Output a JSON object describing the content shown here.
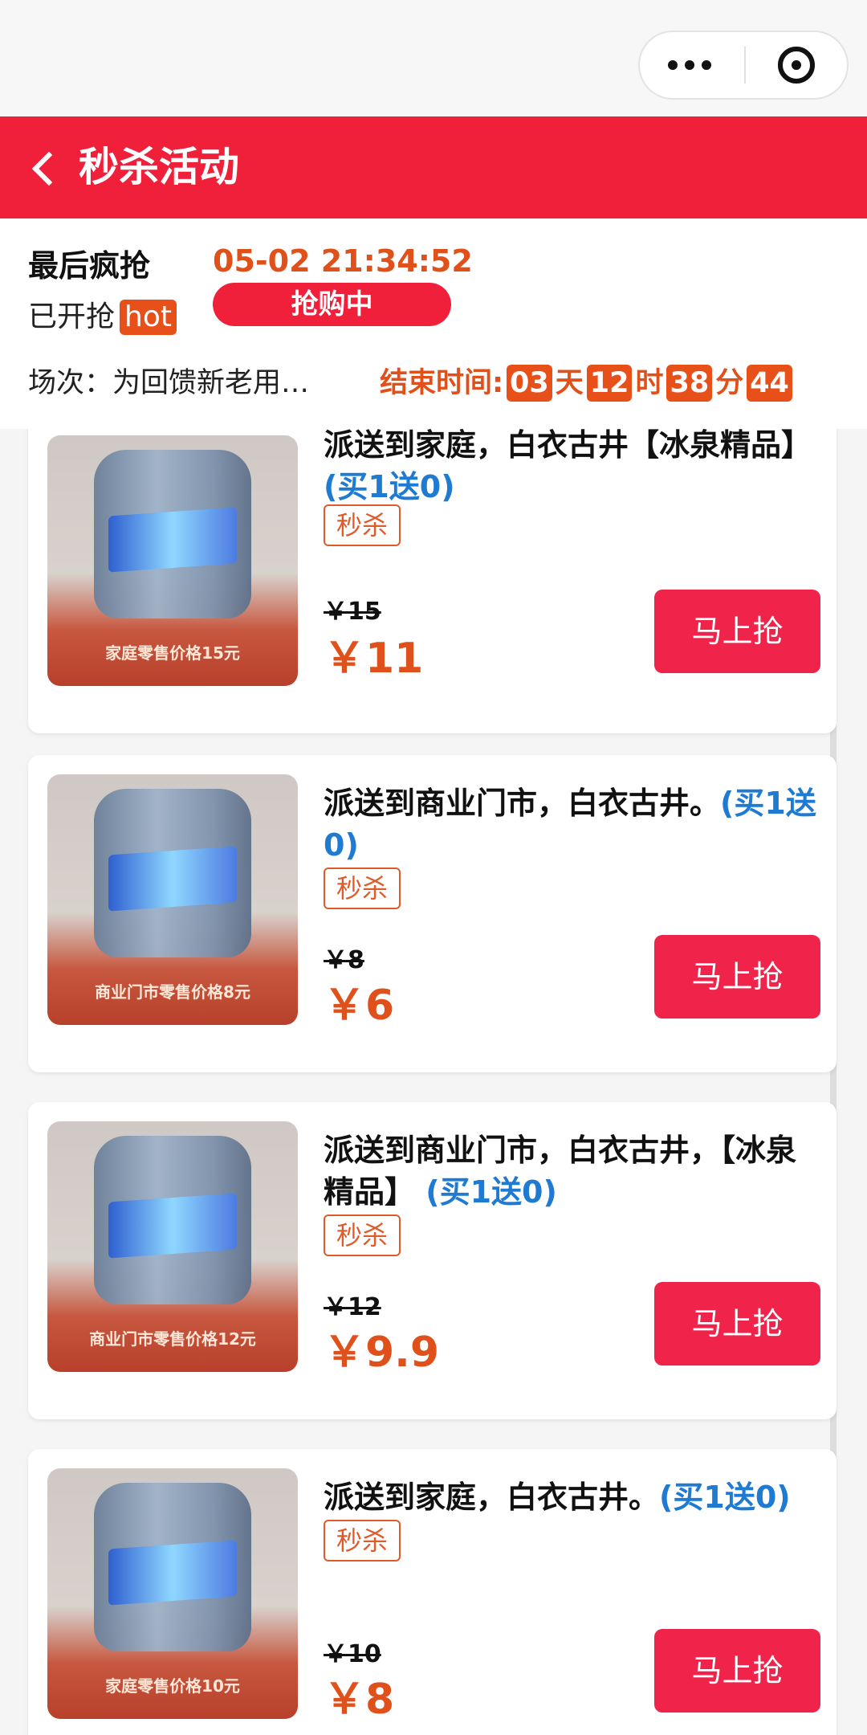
{
  "header": {
    "title": "秒杀活动"
  },
  "info": {
    "last_rush": "最后疯抢",
    "started": "已开抢",
    "hot_badge": "hot",
    "countdown_time": "05-02 21:34:52",
    "status": "抢购中",
    "session": "场次：为回馈新老用…",
    "end_label": "结束时间:",
    "end": {
      "days": "03",
      "days_unit": "天",
      "hours": "12",
      "hours_unit": "时",
      "minutes": "38",
      "minutes_unit": "分",
      "seconds": "44"
    }
  },
  "products": [
    {
      "name": "派送到家庭，白衣古井【冰泉精品】",
      "promo": "(买1送0)",
      "tag": "秒杀",
      "orig_price": "￥15",
      "price": "￥11",
      "button": "马上抢",
      "image_caption": "家庭零售价格15元"
    },
    {
      "name": "派送到商业门市，白衣古井。",
      "promo": "(买1送0)",
      "tag": "秒杀",
      "orig_price": "￥8",
      "price": "￥6",
      "button": "马上抢",
      "image_caption": "商业门市零售价格8元"
    },
    {
      "name": "派送到商业门市，白衣古井，【冰泉精品】",
      "promo": "(买1送0)",
      "tag": "秒杀",
      "orig_price": "￥12",
      "price": "￥9.9",
      "button": "马上抢",
      "image_caption": "商业门市零售价格12元"
    },
    {
      "name": "派送到家庭，白衣古井。",
      "promo": "(买1送0)",
      "tag": "秒杀",
      "orig_price": "￥10",
      "price": "￥8",
      "button": "马上抢",
      "image_caption": "家庭零售价格10元"
    }
  ]
}
